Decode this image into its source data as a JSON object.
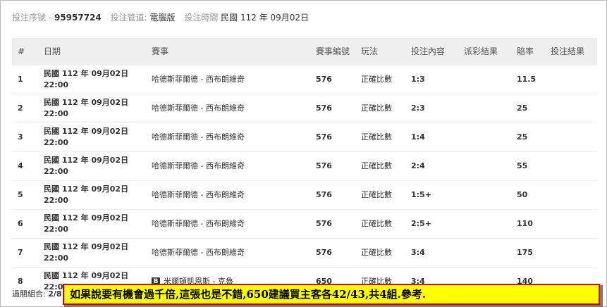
{
  "header": {
    "serial_label": "投注序號 -",
    "serial_value": "95957724",
    "channel_label": "投注管道:",
    "channel_value": "電腦版",
    "time_label": "投注時間",
    "time_value": "民國 112 年 09月02日"
  },
  "table": {
    "columns": [
      "#",
      "日期",
      "賽事",
      "賽事編號",
      "玩法",
      "投注內容",
      "派彩結果",
      "賠率",
      "投注結果"
    ],
    "rows": [
      {
        "no": "1",
        "date1": "民國 112 年 09月02日",
        "date2": "22:00",
        "badge": "",
        "match": "哈德斯菲爾德 - 西布朗維奇",
        "code": "576",
        "play": "正確比數",
        "pick": "1:3",
        "payout": "",
        "odds": "11.5",
        "result": ""
      },
      {
        "no": "2",
        "date1": "民國 112 年 09月02日",
        "date2": "22:00",
        "badge": "",
        "match": "哈德斯菲爾德 - 西布朗維奇",
        "code": "576",
        "play": "正確比數",
        "pick": "2:3",
        "payout": "",
        "odds": "25",
        "result": ""
      },
      {
        "no": "3",
        "date1": "民國 112 年 09月02日",
        "date2": "22:00",
        "badge": "",
        "match": "哈德斯菲爾德 - 西布朗維奇",
        "code": "576",
        "play": "正確比數",
        "pick": "1:4",
        "payout": "",
        "odds": "25",
        "result": ""
      },
      {
        "no": "4",
        "date1": "民國 112 年 09月02日",
        "date2": "22:00",
        "badge": "",
        "match": "哈德斯菲爾德 - 西布朗維奇",
        "code": "576",
        "play": "正確比數",
        "pick": "2:4",
        "payout": "",
        "odds": "55",
        "result": ""
      },
      {
        "no": "5",
        "date1": "民國 112 年 09月02日",
        "date2": "22:00",
        "badge": "",
        "match": "哈德斯菲爾德 - 西布朗維奇",
        "code": "576",
        "play": "正確比數",
        "pick": "1:5+",
        "payout": "",
        "odds": "50",
        "result": ""
      },
      {
        "no": "6",
        "date1": "民國 112 年 09月02日",
        "date2": "22:00",
        "badge": "",
        "match": "哈德斯菲爾德 - 西布朗維奇",
        "code": "576",
        "play": "正確比數",
        "pick": "2:5+",
        "payout": "",
        "odds": "110",
        "result": ""
      },
      {
        "no": "7",
        "date1": "民國 112 年 09月02日",
        "date2": "22:00",
        "badge": "",
        "match": "哈德斯菲爾德 - 西布朗維奇",
        "code": "576",
        "play": "正確比數",
        "pick": "3:4",
        "payout": "",
        "odds": "175",
        "result": ""
      },
      {
        "no": "8",
        "date1": "民國 112 年 09月02日",
        "date2": "22:00",
        "badge": "B",
        "match": "米爾頓凱恩斯 - 克魯",
        "code": "650",
        "play": "正確比數",
        "pick": "3:4",
        "payout": "",
        "odds": "140",
        "result": ""
      }
    ]
  },
  "footer": {
    "combo_label": "過關組合:",
    "combo_value": "2/8"
  },
  "note": {
    "text": "如果說要有機會過千倍,這張也是不錯,650建議買主客各42/43,共4組.參考."
  }
}
